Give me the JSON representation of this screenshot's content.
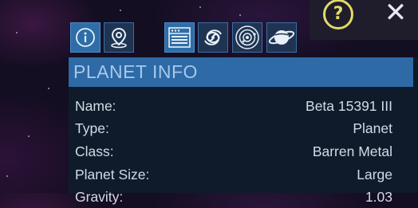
{
  "toolbar": {
    "left_group": [
      {
        "icon": "info-icon",
        "active": true
      },
      {
        "icon": "location-pin-icon",
        "active": false
      }
    ],
    "right_group": [
      {
        "icon": "list-icon",
        "active": true
      },
      {
        "icon": "galaxy-icon",
        "active": false
      },
      {
        "icon": "solar-system-icon",
        "active": false
      },
      {
        "icon": "planet-icon",
        "active": false
      }
    ]
  },
  "top_right": {
    "help_label": "?",
    "close_label": "✕"
  },
  "panel": {
    "title": "PLANET INFO",
    "rows": [
      {
        "label": "Name:",
        "value": "Beta 15391 III"
      },
      {
        "label": "Type:",
        "value": "Planet"
      },
      {
        "label": "Class:",
        "value": "Barren Metal"
      },
      {
        "label": "Planet Size:",
        "value": "Large"
      },
      {
        "label": "Gravity:",
        "value": "1.03"
      }
    ]
  },
  "colors": {
    "accent": "#2d6aa6",
    "help": "#e3d96a",
    "panel_bg": "#0f1b2b"
  }
}
